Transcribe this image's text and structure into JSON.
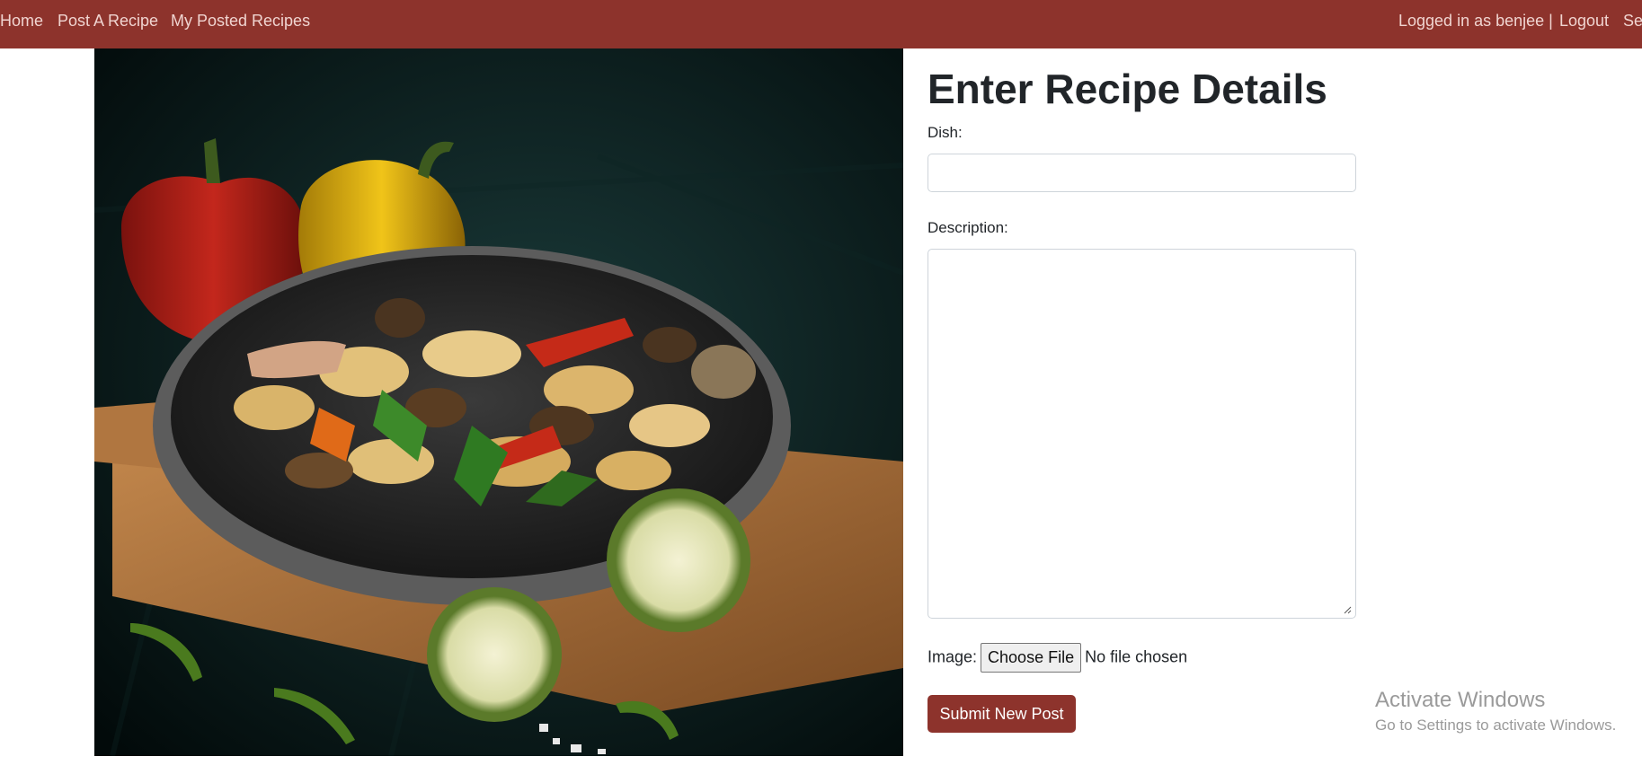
{
  "navbar": {
    "links": [
      "Home",
      "Post A Recipe",
      "My Posted Recipes"
    ],
    "user_status": "Logged in as benjee |",
    "logout": "Logout",
    "settings_partial": "Se",
    "bg_color": "#8d332c"
  },
  "hero": {
    "image_icon": "food-photo-icon"
  },
  "form": {
    "title": "Enter Recipe Details",
    "dish_label": "Dish:",
    "dish_value": "",
    "description_label": "Description:",
    "description_value": "",
    "image_label": "Image:",
    "choose_file": "Choose File",
    "no_file": "No file chosen",
    "submit": "Submit New Post",
    "accent_color": "#8d332c"
  },
  "watermark": {
    "title": "Activate Windows",
    "subtitle": "Go to Settings to activate Windows."
  }
}
